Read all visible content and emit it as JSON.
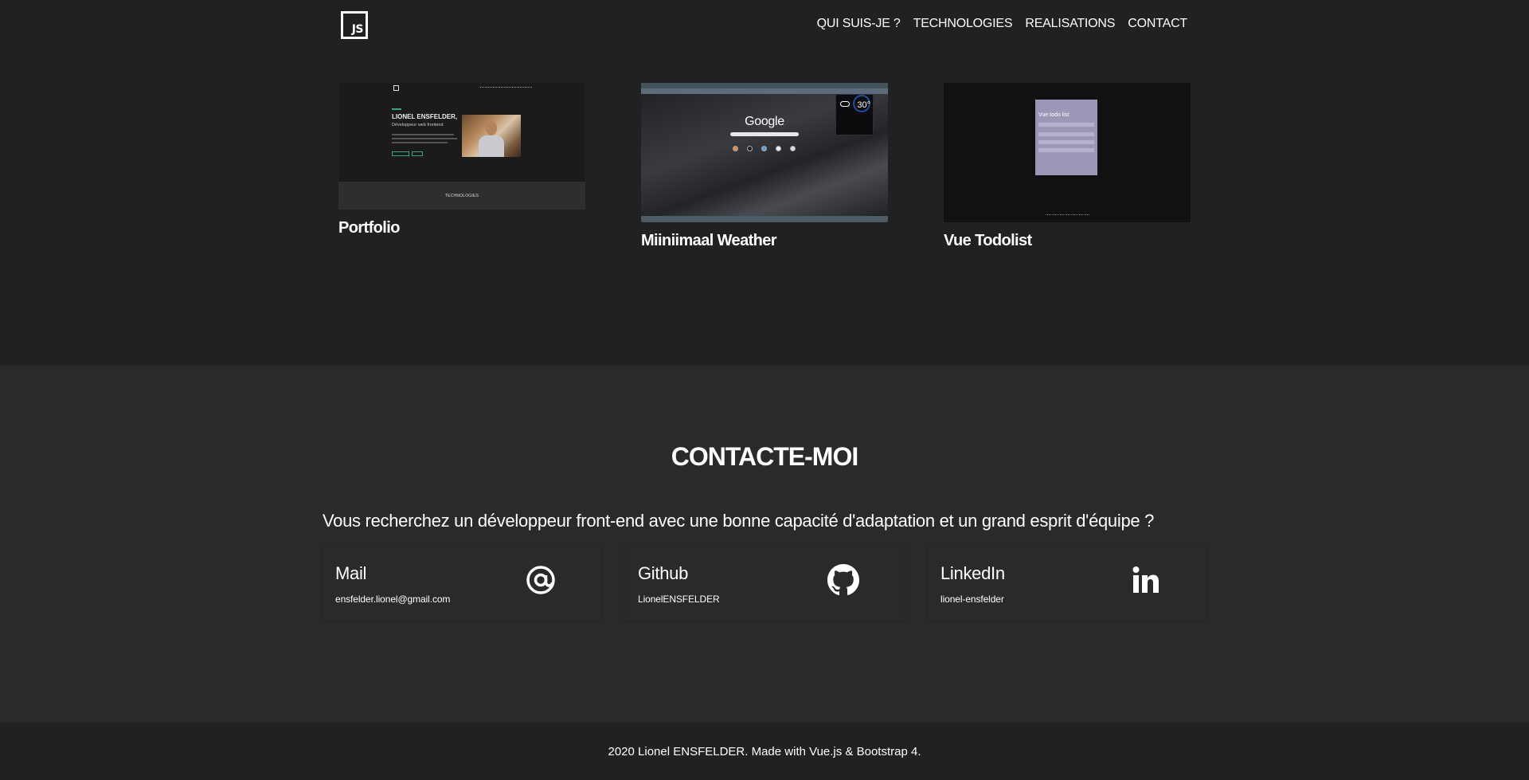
{
  "nav": {
    "logo_text": "JS",
    "items": [
      {
        "label": "QUI SUIS-JE ?"
      },
      {
        "label": "TECHNOLOGIES"
      },
      {
        "label": "REALISATIONS"
      },
      {
        "label": "CONTACT"
      }
    ]
  },
  "projects": {
    "cards": [
      {
        "title": "Portfolio",
        "thumb": {
          "name": "LIONEL ENSFELDER,",
          "subtitle": "Développeur web frontend",
          "bar_label": "TECHNOLOGIES"
        }
      },
      {
        "title": "Miiniimaal Weather",
        "thumb": {
          "search_logo": "Google",
          "temperature": "30°"
        }
      },
      {
        "title": "Vue Todolist",
        "thumb": {
          "heading": "Vue todo list"
        }
      }
    ]
  },
  "contact": {
    "title": "CONTACTE-MOI",
    "lead": "Vous recherchez un développeur front-end avec une bonne capacité d'adaptation et un grand esprit d'équipe ?",
    "cards": [
      {
        "title": "Mail",
        "value": "ensfelder.lionel@gmail.com",
        "icon": "at-icon"
      },
      {
        "title": "Github",
        "value": "LionelENSFELDER",
        "icon": "github-icon"
      },
      {
        "title": "LinkedIn",
        "value": "lionel-ensfelder",
        "icon": "linkedin-icon"
      }
    ]
  },
  "footer": {
    "text": "2020 Lionel ENSFELDER. Made with Vue.js & Bootstrap 4."
  }
}
